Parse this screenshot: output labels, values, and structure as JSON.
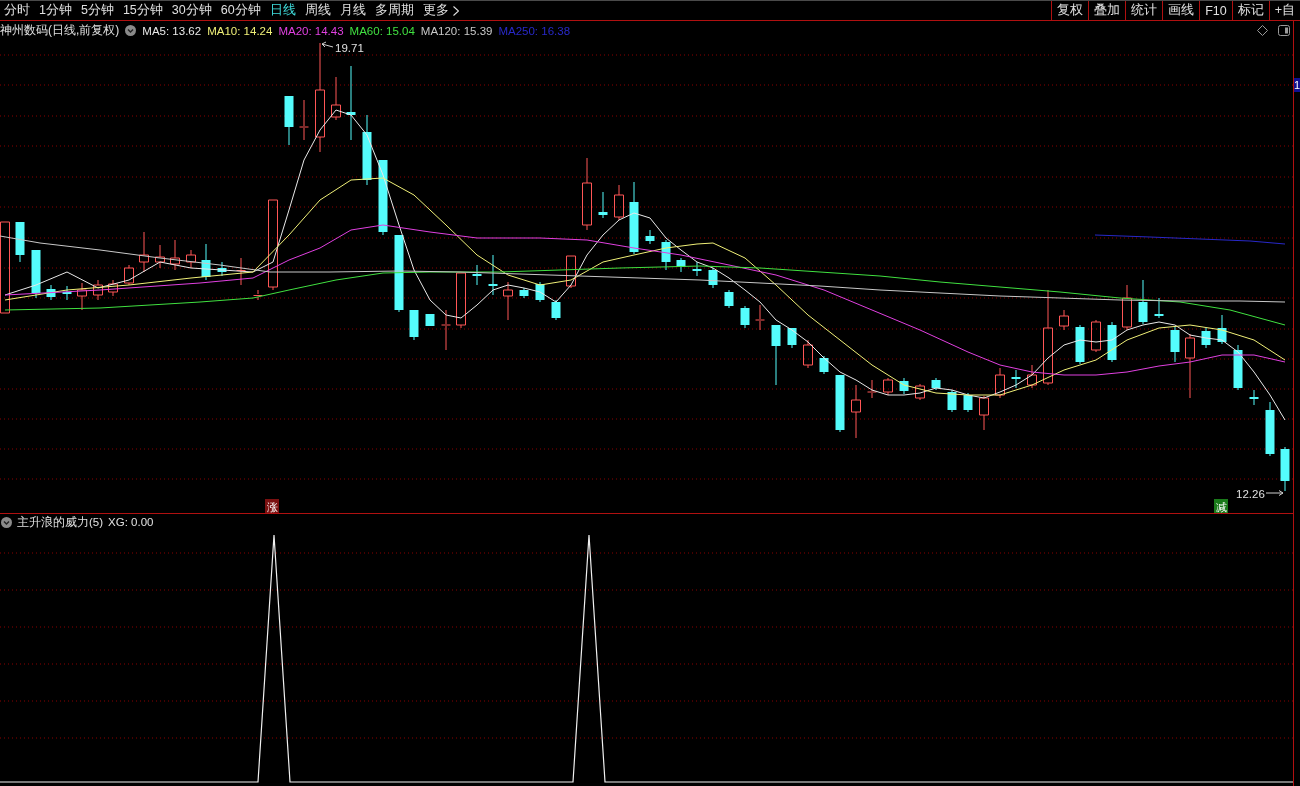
{
  "toolbar": {
    "periods": [
      {
        "label": "分时",
        "selected": false,
        "kind": "period"
      },
      {
        "label": "1分钟",
        "selected": false,
        "kind": "period"
      },
      {
        "label": "5分钟",
        "selected": false,
        "kind": "period"
      },
      {
        "label": "15分钟",
        "selected": false,
        "kind": "period"
      },
      {
        "label": "30分钟",
        "selected": false,
        "kind": "period"
      },
      {
        "label": "60分钟",
        "selected": false,
        "kind": "period"
      },
      {
        "label": "日线",
        "selected": true,
        "kind": "period"
      },
      {
        "label": "周线",
        "selected": false,
        "kind": "period"
      },
      {
        "label": "月线",
        "selected": false,
        "kind": "period"
      },
      {
        "label": "多周期",
        "selected": false,
        "kind": "period"
      },
      {
        "label": "更多",
        "selected": false,
        "kind": "menu"
      }
    ],
    "buttons": [
      "复权",
      "叠加",
      "统计",
      "画线",
      "F10",
      "标记",
      "+自"
    ]
  },
  "price_chart": {
    "title": "神州数码(日线,前复权)",
    "moving_averages": [
      {
        "label": "MA5: 13.62",
        "color": "#e8e8e8"
      },
      {
        "label": "MA10: 14.24",
        "color": "#f0f078"
      },
      {
        "label": "MA20: 14.43",
        "color": "#e040e0"
      },
      {
        "label": "MA60: 15.04",
        "color": "#40e040"
      },
      {
        "label": "MA120: 15.39",
        "color": "#c8c8c8"
      },
      {
        "label": "MA250: 16.38",
        "color": "#2828c8"
      }
    ],
    "high_label": "19.71",
    "low_label": "12.26",
    "signals": [
      {
        "text": "涨",
        "kind": "rise"
      },
      {
        "text": "减",
        "kind": "reduce"
      }
    ],
    "axis_label": "1"
  },
  "indicator": {
    "title": "主升浪的威力(5)",
    "reading": "XG: 0.00"
  }
}
